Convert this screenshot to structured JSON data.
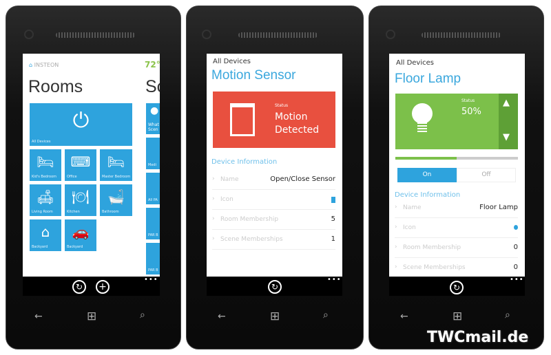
{
  "phone1": {
    "logo": "INSTEON",
    "temperature": "72°",
    "title": "Rooms",
    "next_panel_title": "Sc",
    "tiles": [
      {
        "label": "All Devices",
        "icon": "power-icon"
      },
      {
        "label": "Kid's Bedroom",
        "icon": "bed-icon"
      },
      {
        "label": "Office",
        "icon": "desk-icon"
      },
      {
        "label": "Master Bedroom",
        "icon": "bed-icon"
      },
      {
        "label": "Living Room",
        "icon": "sofa-icon"
      },
      {
        "label": "Kitchen",
        "icon": "plate-icon"
      },
      {
        "label": "Bathroom",
        "icon": "bathtub-icon"
      },
      {
        "label": "Backyard",
        "icon": "house-icon"
      },
      {
        "label": "Backyard",
        "icon": "garage-icon"
      }
    ],
    "scene_tiles": [
      "What Scen",
      "Medi",
      "All PA",
      "PAR B",
      "PAR B"
    ],
    "appbar": {
      "sync": "↻",
      "add": "+",
      "more": "•••"
    }
  },
  "phone2": {
    "breadcrumb": "All Devices",
    "title": "Motion Sensor",
    "status_label": "Status",
    "status_value": "Motion Detected",
    "tile_color": "#e8503f",
    "section": "Device Information",
    "rows": [
      {
        "key": "Name",
        "value": "Open/Close Sensor"
      },
      {
        "key": "Icon",
        "value": ""
      },
      {
        "key": "Room Membership",
        "value": "5"
      },
      {
        "key": "Scene Memberships",
        "value": "1"
      }
    ],
    "appbar": {
      "sync": "↻",
      "more": "•••"
    }
  },
  "phone3": {
    "breadcrumb": "All Devices",
    "title": "Floor Lamp",
    "status_label": "Status",
    "status_value": "50%",
    "level_percent": 50,
    "tile_color": "#7cc04a",
    "on_label": "On",
    "off_label": "Off",
    "selected": "On",
    "section": "Device Information",
    "rows": [
      {
        "key": "Name",
        "value": "Floor Lamp"
      },
      {
        "key": "Icon",
        "value": ""
      },
      {
        "key": "Room Membership",
        "value": "0"
      },
      {
        "key": "Scene Memberships",
        "value": "0"
      }
    ],
    "appbar": {
      "sync": "↻",
      "more": "•••"
    }
  },
  "nav": {
    "back": "←",
    "start": "⊞",
    "search": "⌕"
  },
  "watermark": "TWCmail.de"
}
